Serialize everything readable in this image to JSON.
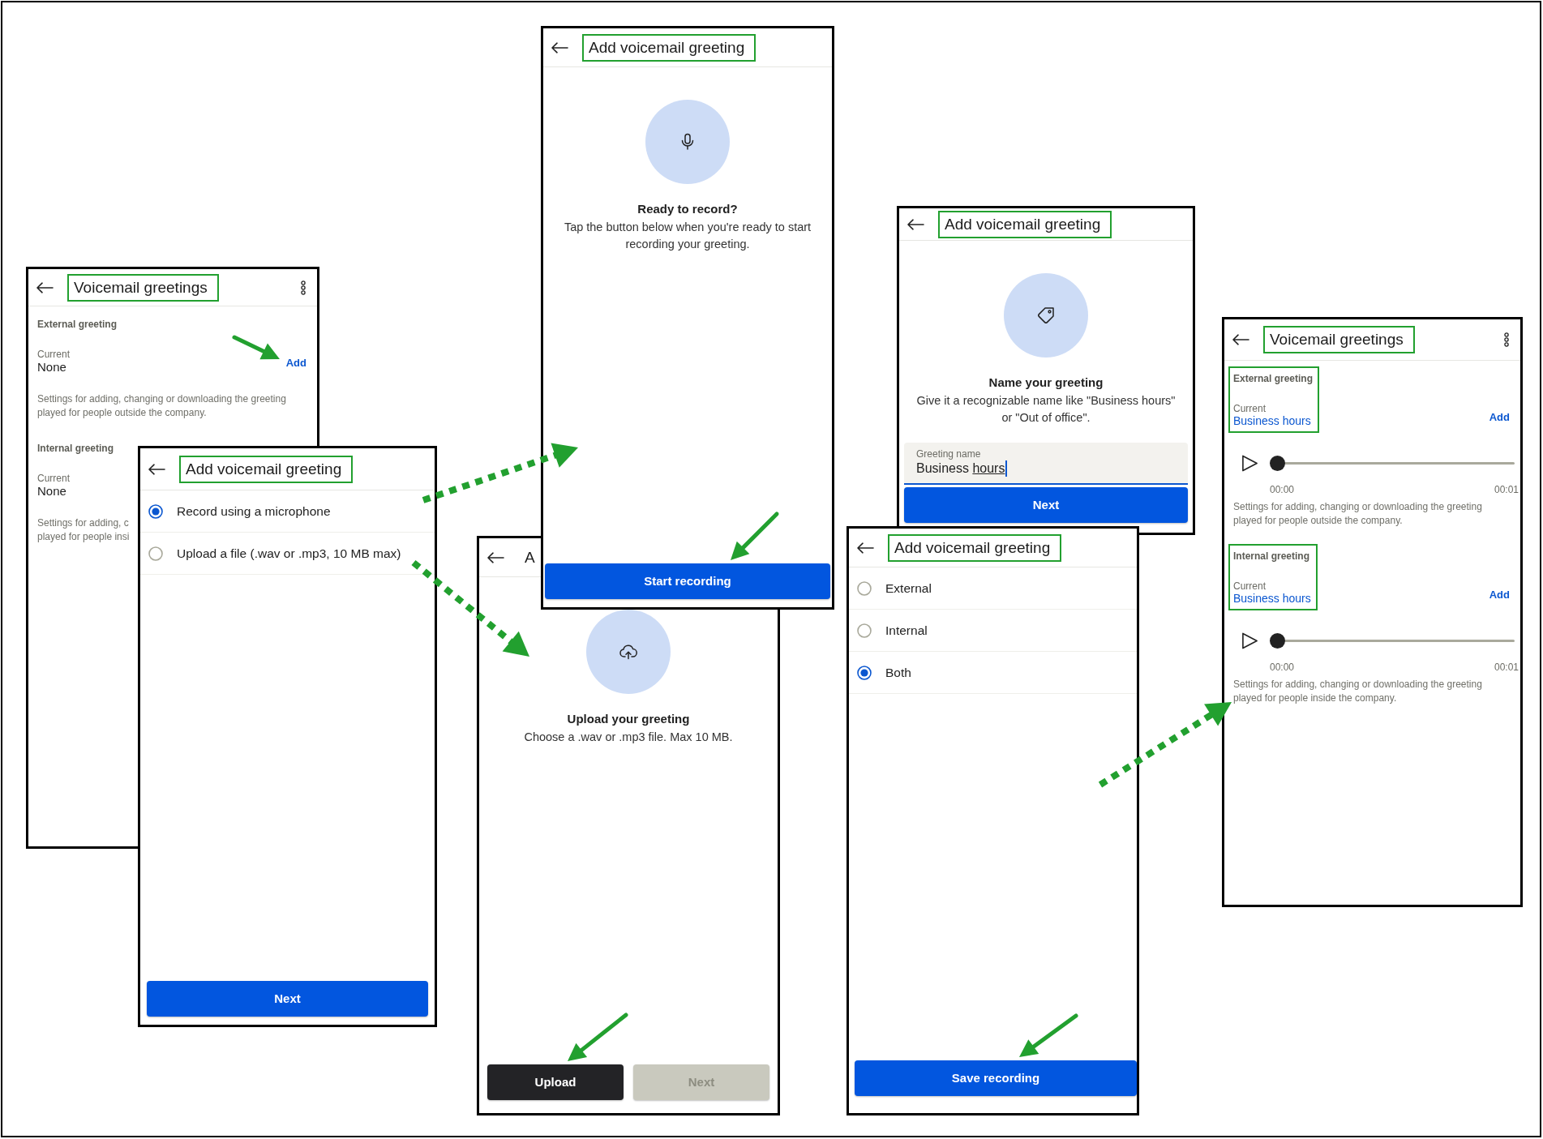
{
  "screens": [
    {
      "kind": "greetings",
      "title": "Voicemail greetings",
      "title_highlighted": true,
      "sections": [
        {
          "heading": "External greeting",
          "current_label": "Current",
          "current_value": "None",
          "linked": false,
          "action": "Add",
          "description": "Settings for adding, changing or downloading the greeting played for people outside the company.",
          "highlighted": false
        },
        {
          "heading": "Internal greeting",
          "current_label": "Current",
          "current_value": "None",
          "linked": false,
          "description": "Settings for adding, c\nplayed for people insi",
          "highlighted": false
        }
      ]
    },
    {
      "kind": "options",
      "title": "Add voicemail greeting",
      "title_highlighted": true,
      "options": [
        {
          "label": "Record using a microphone",
          "selected": true
        },
        {
          "label": "Upload a file (.wav or .mp3, 10 MB max)",
          "selected": false
        }
      ],
      "buttons": [
        {
          "label": "Next",
          "kind": "primary",
          "disabled": false
        }
      ]
    },
    {
      "kind": "record",
      "title": "Add voicemail greeting",
      "title_highlighted": true,
      "heading": "Ready to record?",
      "text": "Tap the button below when you're ready to start recording your greeting.",
      "buttons": [
        {
          "label": "Start recording",
          "kind": "primary",
          "disabled": false
        }
      ]
    },
    {
      "kind": "upload",
      "title": "A",
      "title_highlighted": false,
      "heading": "Upload your greeting",
      "text": "Choose a .wav or .mp3 file. Max 10 MB.",
      "buttons": [
        {
          "label": "Upload",
          "kind": "dark",
          "disabled": false
        },
        {
          "label": "Next",
          "kind": "primary",
          "disabled": true
        }
      ]
    },
    {
      "kind": "name",
      "title": "Add voicemail greeting",
      "title_highlighted": true,
      "heading": "Name your greeting",
      "text": "Give it a recognizable name like \"Business hours\" or \"Out of office\".",
      "field": {
        "label": "Greeting name",
        "value": "Business",
        "composing": "hours",
        "focused": true
      },
      "buttons": [
        {
          "label": "Next",
          "kind": "primary",
          "disabled": false
        }
      ]
    },
    {
      "kind": "options",
      "title": "Add voicemail greeting",
      "title_highlighted": true,
      "options": [
        {
          "label": "External",
          "selected": false
        },
        {
          "label": "Internal",
          "selected": false
        },
        {
          "label": "Both",
          "selected": true
        }
      ],
      "buttons": [
        {
          "label": "Save recording",
          "kind": "primary",
          "disabled": false
        }
      ]
    },
    {
      "kind": "greetings",
      "title": "Voicemail greetings",
      "title_highlighted": true,
      "sections": [
        {
          "heading": "External greeting",
          "current_label": "Current",
          "current_value": "Business hours",
          "linked": true,
          "action": "Add",
          "player": {
            "start": "00:00",
            "end": "00:01",
            "level": 0
          },
          "description": "Settings for adding, changing or downloading the greeting played for people outside the company.",
          "highlighted": true
        },
        {
          "heading": "Internal greeting",
          "current_label": "Current",
          "current_value": "Business hours",
          "linked": true,
          "action": "Add",
          "player": {
            "start": "00:00",
            "end": "00:01",
            "level": 0
          },
          "description": "Settings for adding, changing or downloading the greeting played for people inside the company.",
          "highlighted": true
        }
      ]
    }
  ]
}
